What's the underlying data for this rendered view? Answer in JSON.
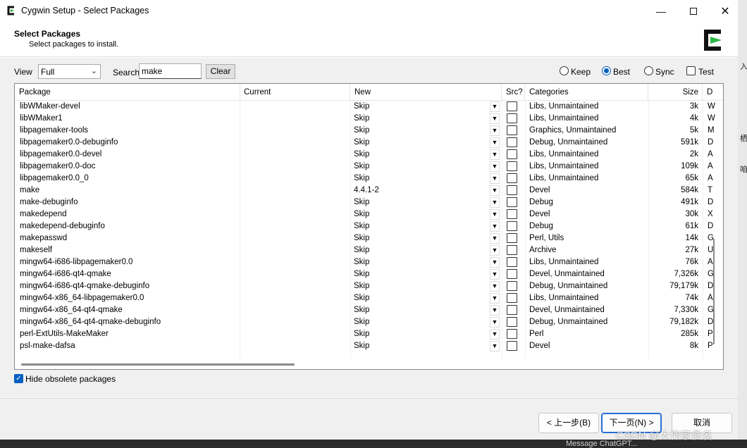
{
  "window": {
    "title": "Cygwin Setup - Select Packages"
  },
  "header": {
    "title": "Select Packages",
    "subtitle": "Select packages to install."
  },
  "toolbar": {
    "view_label": "View",
    "view_value": "Full",
    "search_label": "Search",
    "search_value": "make",
    "clear_label": "Clear",
    "options": {
      "keep": "Keep",
      "best": "Best",
      "sync": "Sync",
      "test": "Test"
    },
    "selected_option": "Best"
  },
  "table": {
    "columns": {
      "package": "Package",
      "current": "Current",
      "new": "New",
      "src": "Src?",
      "categories": "Categories",
      "size": "Size",
      "desc": "D"
    },
    "rows": [
      {
        "package": "libWMaker-devel",
        "current": "",
        "new": "Skip",
        "categories": "Libs, Unmaintained",
        "size": "3k",
        "desc": "W"
      },
      {
        "package": "libWMaker1",
        "current": "",
        "new": "Skip",
        "categories": "Libs, Unmaintained",
        "size": "4k",
        "desc": "W"
      },
      {
        "package": "libpagemaker-tools",
        "current": "",
        "new": "Skip",
        "categories": "Graphics, Unmaintained",
        "size": "5k",
        "desc": "M"
      },
      {
        "package": "libpagemaker0.0-debuginfo",
        "current": "",
        "new": "Skip",
        "categories": "Debug, Unmaintained",
        "size": "591k",
        "desc": "D"
      },
      {
        "package": "libpagemaker0.0-devel",
        "current": "",
        "new": "Skip",
        "categories": "Libs, Unmaintained",
        "size": "2k",
        "desc": "A"
      },
      {
        "package": "libpagemaker0.0-doc",
        "current": "",
        "new": "Skip",
        "categories": "Libs, Unmaintained",
        "size": "109k",
        "desc": "A"
      },
      {
        "package": "libpagemaker0.0_0",
        "current": "",
        "new": "Skip",
        "categories": "Libs, Unmaintained",
        "size": "65k",
        "desc": "A"
      },
      {
        "package": "make",
        "current": "",
        "new": "4.4.1-2",
        "categories": "Devel",
        "size": "584k",
        "desc": "T"
      },
      {
        "package": "make-debuginfo",
        "current": "",
        "new": "Skip",
        "categories": "Debug",
        "size": "491k",
        "desc": "D"
      },
      {
        "package": "makedepend",
        "current": "",
        "new": "Skip",
        "categories": "Devel",
        "size": "30k",
        "desc": "X"
      },
      {
        "package": "makedepend-debuginfo",
        "current": "",
        "new": "Skip",
        "categories": "Debug",
        "size": "61k",
        "desc": "D"
      },
      {
        "package": "makepasswd",
        "current": "",
        "new": "Skip",
        "categories": "Perl, Utils",
        "size": "14k",
        "desc": "G"
      },
      {
        "package": "makeself",
        "current": "",
        "new": "Skip",
        "categories": "Archive",
        "size": "27k",
        "desc": "U"
      },
      {
        "package": "mingw64-i686-libpagemaker0.0",
        "current": "",
        "new": "Skip",
        "categories": "Libs, Unmaintained",
        "size": "76k",
        "desc": "A"
      },
      {
        "package": "mingw64-i686-qt4-qmake",
        "current": "",
        "new": "Skip",
        "categories": "Devel, Unmaintained",
        "size": "7,326k",
        "desc": "G"
      },
      {
        "package": "mingw64-i686-qt4-qmake-debuginfo",
        "current": "",
        "new": "Skip",
        "categories": "Debug, Unmaintained",
        "size": "79,179k",
        "desc": "D"
      },
      {
        "package": "mingw64-x86_64-libpagemaker0.0",
        "current": "",
        "new": "Skip",
        "categories": "Libs, Unmaintained",
        "size": "74k",
        "desc": "A"
      },
      {
        "package": "mingw64-x86_64-qt4-qmake",
        "current": "",
        "new": "Skip",
        "categories": "Devel, Unmaintained",
        "size": "7,330k",
        "desc": "G"
      },
      {
        "package": "mingw64-x86_64-qt4-qmake-debuginfo",
        "current": "",
        "new": "Skip",
        "categories": "Debug, Unmaintained",
        "size": "79,182k",
        "desc": "D"
      },
      {
        "package": "perl-ExtUtils-MakeMaker",
        "current": "",
        "new": "Skip",
        "categories": "Perl",
        "size": "285k",
        "desc": "P"
      },
      {
        "package": "psl-make-dafsa",
        "current": "",
        "new": "Skip",
        "categories": "Devel",
        "size": "8k",
        "desc": "P"
      }
    ]
  },
  "hide_obsolete": {
    "label": "Hide obsolete packages",
    "checked": true
  },
  "footer": {
    "back_label": "< 上一步(B)",
    "next_label": "下一页(N) >",
    "cancel_label": "取消"
  },
  "background": {
    "right_glyphs": [
      "入",
      "栖",
      "咱"
    ],
    "bottom_text": "Message ChatGPT...",
    "watermark": "CSDN @大作家佚名"
  },
  "colors": {
    "accent": "#0060c0",
    "primary_button_border": "#2b6fd6",
    "panel": "#f0f0f0"
  }
}
